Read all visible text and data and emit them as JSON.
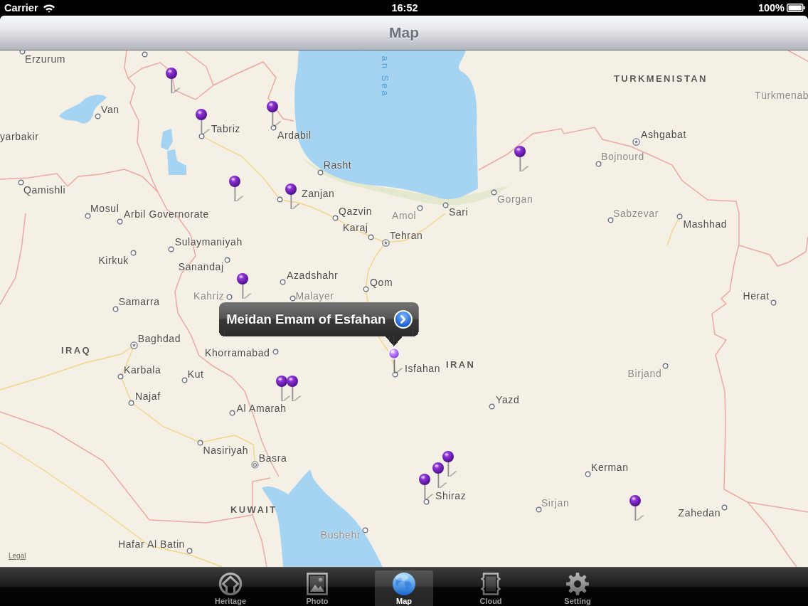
{
  "status_bar": {
    "carrier": "Carrier",
    "time": "16:52",
    "battery": "100%"
  },
  "nav_bar": {
    "title": "Map"
  },
  "map": {
    "places": [
      {
        "name": "Erzurum",
        "kind": "city"
      },
      {
        "name": "an Sea",
        "kind": "water"
      },
      {
        "name": "TURKMENISTAN",
        "kind": "country"
      },
      {
        "name": "Türkmenab",
        "kind": "town"
      },
      {
        "name": "Van",
        "kind": "city"
      },
      {
        "name": "yarbakir",
        "kind": "city"
      },
      {
        "name": "Tabriz",
        "kind": "city"
      },
      {
        "name": "Ardabil",
        "kind": "city"
      },
      {
        "name": "Ashgabat",
        "kind": "capital"
      },
      {
        "name": "Bojnourd",
        "kind": "town"
      },
      {
        "name": "Rasht",
        "kind": "city"
      },
      {
        "name": "Qamishli",
        "kind": "city"
      },
      {
        "name": "Zanjan",
        "kind": "city"
      },
      {
        "name": "Gorgan",
        "kind": "town"
      },
      {
        "name": "Mosul",
        "kind": "city"
      },
      {
        "name": "Arbil Governorate",
        "kind": "city"
      },
      {
        "name": "Qazvin",
        "kind": "city"
      },
      {
        "name": "Amol",
        "kind": "town"
      },
      {
        "name": "Sari",
        "kind": "city"
      },
      {
        "name": "Sabzevar",
        "kind": "town"
      },
      {
        "name": "Karaj",
        "kind": "city"
      },
      {
        "name": "Mashhad",
        "kind": "city"
      },
      {
        "name": "Tehran",
        "kind": "capital"
      },
      {
        "name": "Sulaymaniyah",
        "kind": "city"
      },
      {
        "name": "Kirkuk",
        "kind": "city"
      },
      {
        "name": "Sanandaj",
        "kind": "city"
      },
      {
        "name": "Azadshahr",
        "kind": "city"
      },
      {
        "name": "Qom",
        "kind": "city"
      },
      {
        "name": "Samarra",
        "kind": "city"
      },
      {
        "name": "Kahriz",
        "kind": "town"
      },
      {
        "name": "Malayer",
        "kind": "town"
      },
      {
        "name": "Herat",
        "kind": "city"
      },
      {
        "name": "Baghdad",
        "kind": "capital"
      },
      {
        "name": "IRAQ",
        "kind": "country"
      },
      {
        "name": "Khorramabad",
        "kind": "city"
      },
      {
        "name": "Karbala",
        "kind": "city"
      },
      {
        "name": "Kut",
        "kind": "city"
      },
      {
        "name": "Isfahan",
        "kind": "city"
      },
      {
        "name": "IRAN",
        "kind": "country"
      },
      {
        "name": "Birjand",
        "kind": "town"
      },
      {
        "name": "Najaf",
        "kind": "city"
      },
      {
        "name": "Al Amarah",
        "kind": "city"
      },
      {
        "name": "Yazd",
        "kind": "city"
      },
      {
        "name": "Nasiriyah",
        "kind": "city"
      },
      {
        "name": "Basra",
        "kind": "major"
      },
      {
        "name": "Kerman",
        "kind": "city"
      },
      {
        "name": "Shiraz",
        "kind": "city"
      },
      {
        "name": "Sirjan",
        "kind": "town"
      },
      {
        "name": "KUWAIT",
        "kind": "country"
      },
      {
        "name": "Zahedan",
        "kind": "city"
      },
      {
        "name": "Bushehr",
        "kind": "town"
      },
      {
        "name": "Hafar Al Batin",
        "kind": "city"
      }
    ],
    "pins": [
      {
        "selected": false
      },
      {
        "selected": false
      },
      {
        "selected": false
      },
      {
        "selected": false
      },
      {
        "selected": false
      },
      {
        "selected": false
      },
      {
        "selected": false
      },
      {
        "selected": true
      },
      {
        "selected": false
      },
      {
        "selected": false
      },
      {
        "selected": false
      },
      {
        "selected": false
      },
      {
        "selected": false
      },
      {
        "selected": false
      }
    ],
    "callout": {
      "title": "Meidan Emam of Esfahan"
    },
    "legal_link": "Legal"
  },
  "tab_bar": {
    "tabs": [
      {
        "label": "Heritage",
        "selected": false
      },
      {
        "label": "Photo",
        "selected": false
      },
      {
        "label": "Map",
        "selected": true
      },
      {
        "label": "Cloud",
        "selected": false
      },
      {
        "label": "Setting",
        "selected": false
      }
    ]
  }
}
